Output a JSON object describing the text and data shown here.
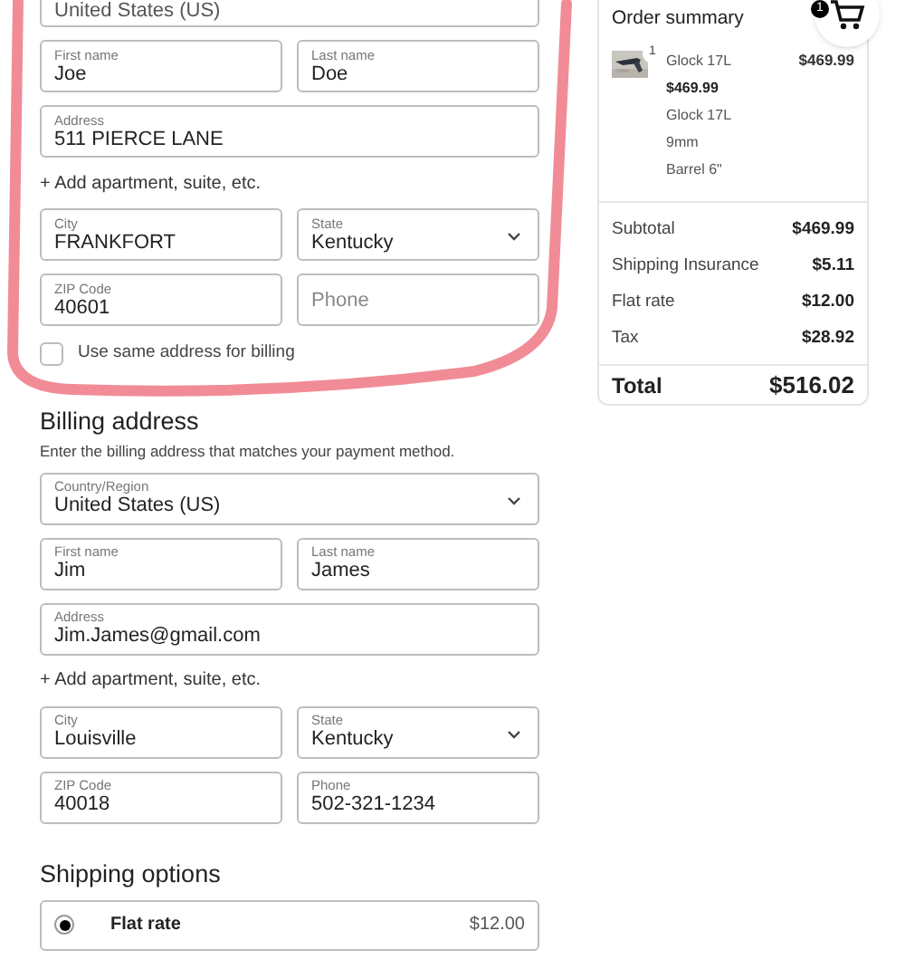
{
  "shipping_form": {
    "rows": [
      [
        {
          "kind": "select",
          "value": "United States (US)"
        }
      ],
      [
        {
          "kind": "text",
          "label": "First name",
          "value": "Joe"
        },
        {
          "kind": "text",
          "label": "Last name",
          "value": "Doe"
        }
      ],
      [
        {
          "kind": "text",
          "label": "Address",
          "value": "511 PIERCE LANE"
        }
      ],
      [
        {
          "kind": "link",
          "value": "+ Add apartment, suite, etc."
        }
      ],
      [
        {
          "kind": "text",
          "label": "City",
          "value": "FRANKFORT"
        },
        {
          "kind": "select",
          "label": "State",
          "value": "Kentucky"
        }
      ],
      [
        {
          "kind": "text",
          "label": "ZIP Code",
          "value": "40601"
        },
        {
          "kind": "text",
          "placeholder": "Phone"
        }
      ]
    ],
    "same_address": {
      "label": "Use same address for billing",
      "checked": false
    }
  },
  "billing": {
    "title": "Billing address",
    "description": "Enter the billing address that matches your payment method.",
    "rows": [
      [
        {
          "kind": "select",
          "label": "Country/Region",
          "value": "United States (US)"
        }
      ],
      [
        {
          "kind": "text",
          "label": "First name",
          "value": "Jim"
        },
        {
          "kind": "text",
          "label": "Last name",
          "value": "James"
        }
      ],
      [
        {
          "kind": "text",
          "label": "Address",
          "value": "Jim.James@gmail.com"
        }
      ],
      [
        {
          "kind": "link",
          "value": "+ Add apartment, suite, etc."
        }
      ],
      [
        {
          "kind": "text",
          "label": "City",
          "value": "Louisville"
        },
        {
          "kind": "select",
          "label": "State",
          "value": "Kentucky"
        }
      ],
      [
        {
          "kind": "text",
          "label": "ZIP Code",
          "value": "40018"
        },
        {
          "kind": "text",
          "label": "Phone",
          "value": "502-321-1234"
        }
      ]
    ]
  },
  "shipping_options": {
    "title": "Shipping options",
    "options": [
      {
        "label": "Flat rate",
        "price": "$12.00",
        "selected": true
      }
    ]
  },
  "order_summary": {
    "title": "Order summary",
    "cart_count": "1",
    "items": [
      {
        "quantity": "1",
        "name": "Glock 17L",
        "unit_price": "$469.99",
        "attributes": [
          "Glock 17L",
          "9mm",
          "Barrel 6\""
        ],
        "price": "$469.99"
      }
    ],
    "lines": [
      {
        "label": "Subtotal",
        "value": "$469.99"
      },
      {
        "label": "Shipping Insurance",
        "value": "$5.11"
      },
      {
        "label": "Flat rate",
        "value": "$12.00"
      },
      {
        "label": "Tax",
        "value": "$28.92"
      }
    ],
    "total": {
      "label": "Total",
      "value": "$516.02"
    }
  }
}
